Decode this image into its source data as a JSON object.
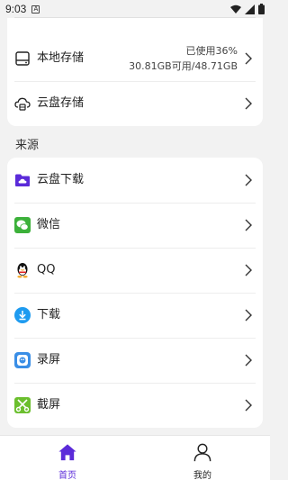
{
  "status_bar": {
    "time": "9:03",
    "notif_letter": "A"
  },
  "storage": {
    "local": {
      "label": "本地存储",
      "used": "已使用36%",
      "capacity": "30.81GB可用/48.71GB"
    },
    "cloud": {
      "label": "云盘存储"
    }
  },
  "source": {
    "title": "来源",
    "items": [
      {
        "label": "云盘下载",
        "icon": "cloud-folder-icon"
      },
      {
        "label": "微信",
        "icon": "wechat-icon"
      },
      {
        "label": "QQ",
        "icon": "qq-penguin-icon"
      },
      {
        "label": "下载",
        "icon": "download-icon"
      },
      {
        "label": "录屏",
        "icon": "screen-record-icon"
      },
      {
        "label": "截屏",
        "icon": "screenshot-scissors-icon"
      }
    ]
  },
  "bottom_nav": {
    "home": {
      "label": "首页"
    },
    "mine": {
      "label": "我的"
    }
  },
  "colors": {
    "accent": "#5b2bd9",
    "wechat": "#3cb13a",
    "download": "#1e9bf0",
    "record": "#3a8ee6",
    "scissors": "#6bbf2e"
  }
}
